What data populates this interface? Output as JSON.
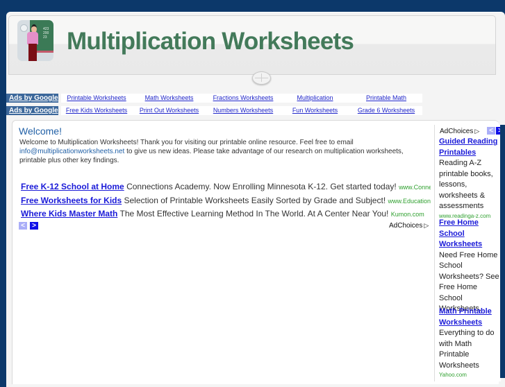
{
  "header": {
    "title": "Multiplication Worksheets",
    "logo_icon": "teacher-chalkboard-logo",
    "logo_board_numbers": [
      "423",
      "200",
      "23"
    ]
  },
  "link_bars": [
    {
      "ads_label": "Ads by Google",
      "links": [
        "Printable Worksheets",
        "Math Worksheets",
        "Fractions Worksheets",
        "Multiplication",
        "Printable Math"
      ]
    },
    {
      "ads_label": "Ads by Google",
      "links": [
        "Free Kids Worksheets",
        "Print Out Worksheets",
        "Numbers Worksheets",
        "Fun Worksheets",
        "Grade 6 Worksheets"
      ]
    }
  ],
  "welcome": {
    "title": "Welcome!",
    "text_before": "Welcome to Multiplication Worksheets! Thank you for visiting our printable online resource. Feel free to email",
    "email": "info@multiplicationworksheets.net",
    "text_after": " to give us new ideas. Please take advantage of our research on multiplication worksheets, printable plus other key findings."
  },
  "text_ads": [
    {
      "title": "Free K-12 School at Home",
      "description": "Connections Academy. Now Enrolling Minnesota K-12. Get started today!",
      "url": "www.Connec..."
    },
    {
      "title": "Free Worksheets for Kids",
      "description": "Selection of Printable Worksheets Easily Sorted by Grade and Subject!",
      "url": "www.Education.c..."
    },
    {
      "title": "Where Kids Master Math",
      "description": "The Most Effective Learning Method In The World. At A Center Near You!",
      "url": "Kumon.com"
    }
  ],
  "ad_nav": {
    "prev": "<",
    "next": ">"
  },
  "adchoices_label": "AdChoices",
  "adchoices_icon": "▷",
  "sidebar_ads": [
    {
      "title": "Guided Reading Printables",
      "description": "Reading A-Z printable books, lessons, worksheets & assessments",
      "url": "www.readinga-z.com"
    },
    {
      "title": "Free Home School Worksheets",
      "description": "Need Free Home School Worksheets? See Free Home School Worksheets.",
      "url": ""
    },
    {
      "title": "Math Printable Worksheets",
      "description": "Everything to do with Math Printable Worksheets",
      "url": "Yahoo.com"
    }
  ],
  "colors": {
    "background": "#0c386a",
    "title_green": "#437a5a",
    "ads_label_bg": "#3b679a",
    "link_blue": "#1f25c9",
    "ad_title_blue": "#1a1ad8",
    "ad_url_green": "#2fa02f",
    "welcome_blue": "#2160a6"
  }
}
